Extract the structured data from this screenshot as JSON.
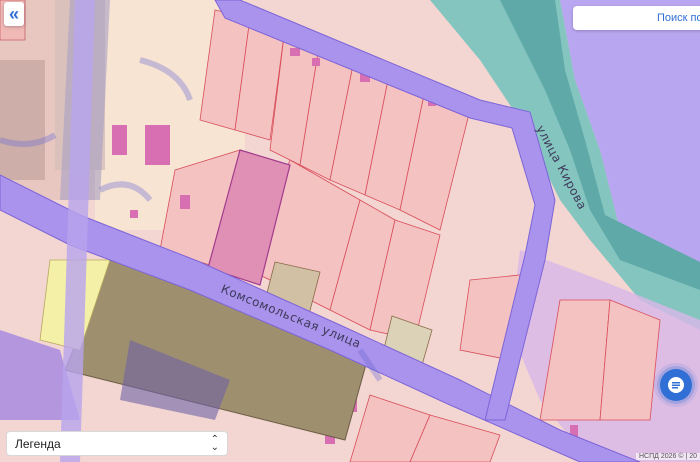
{
  "map": {
    "streets": [
      {
        "name": "Комсомольская улица"
      },
      {
        "name": "улица Кирова"
      }
    ]
  },
  "controls": {
    "collapse_icon": "«",
    "search_placeholder": "Поиск по карте",
    "legend_label": "Легенда",
    "attribution": "НСПД 2026 © | 20"
  },
  "colors": {
    "parcel_fill": "#f4c2c0",
    "parcel_stroke": "#d94d5a",
    "zone_purple": "#b9a6f0",
    "water_teal": "#67b7b6",
    "road": "#9c86e8",
    "accent": "#2f6fd6"
  },
  "icons": [
    "collapse-icon",
    "chat-icon",
    "select-arrows-icon"
  ]
}
